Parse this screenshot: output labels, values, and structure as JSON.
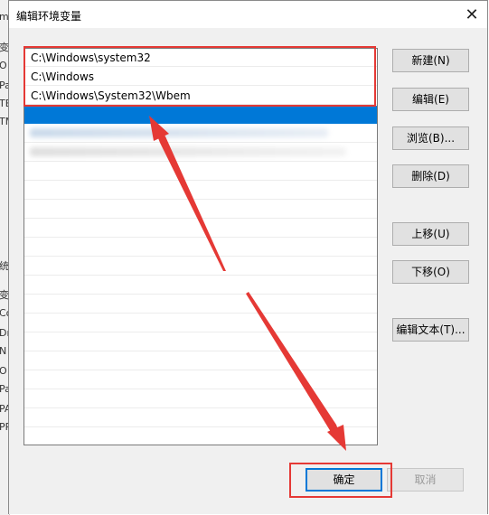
{
  "background_window": {
    "fragments": [
      "m",
      "变",
      "O",
      "Pa",
      "TE",
      "TM",
      "统",
      "变",
      "Co",
      "Dr",
      "N",
      "O",
      "Pa",
      "PA",
      "PR"
    ]
  },
  "dialog": {
    "title": "编辑环境变量",
    "close_glyph": "✕"
  },
  "list": {
    "items": [
      "C:\\Windows\\system32",
      "C:\\Windows",
      "C:\\Windows\\System32\\Wbem"
    ],
    "selected_index": 3
  },
  "buttons": {
    "new": "新建(N)",
    "edit": "编辑(E)",
    "browse": "浏览(B)...",
    "delete": "删除(D)",
    "move_up": "上移(U)",
    "move_down": "下移(O)",
    "edit_text": "编辑文本(T)...",
    "ok": "确定",
    "cancel": "取消"
  },
  "annotation": {
    "color": "#e53935"
  }
}
